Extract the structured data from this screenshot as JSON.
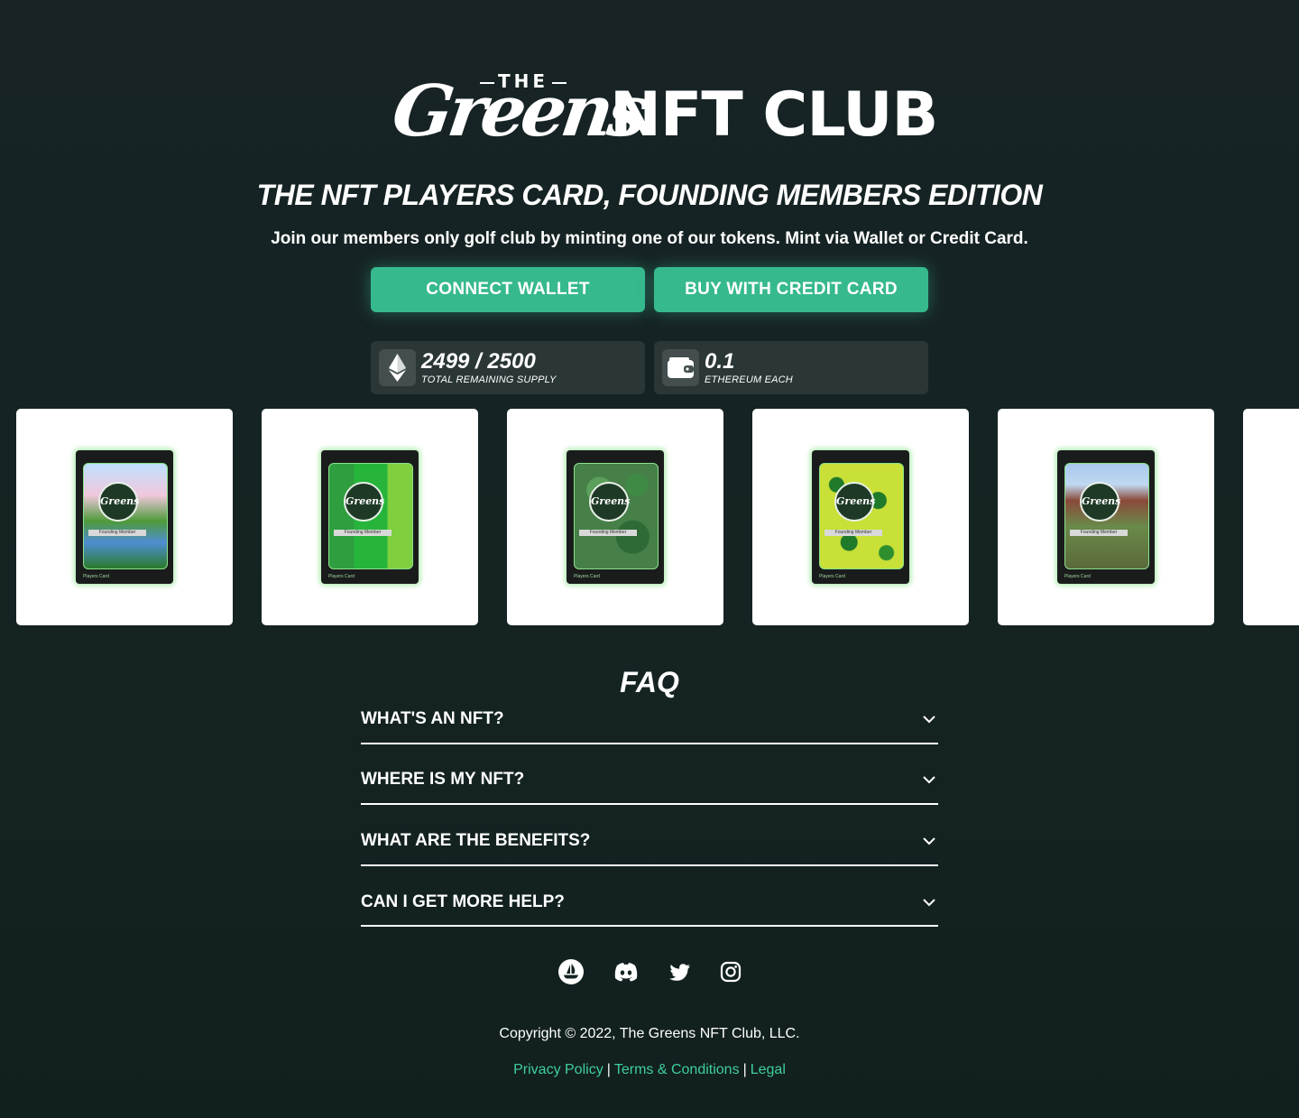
{
  "brand": {
    "the": "THE",
    "script": "Greens",
    "nft_club": "NFT CLUB"
  },
  "hero": {
    "headline": "THE NFT PLAYERS CARD, FOUNDING MEMBERS EDITION",
    "subheadline": "Join our members only golf club by minting one of our tokens. Mint via Wallet or Credit Card."
  },
  "buttons": {
    "connect_wallet": "CONNECT WALLET",
    "buy_credit_card": "BUY WITH CREDIT CARD"
  },
  "stats": {
    "supply": {
      "value": "2499 / 2500",
      "label": "TOTAL REMAINING SUPPLY",
      "icon": "ethereum-icon"
    },
    "price": {
      "value": "0.1",
      "label": "ETHEREUM EACH",
      "icon": "wallet-icon"
    }
  },
  "cards": [
    {
      "badge": "Greens",
      "ribbon": "Founding Member",
      "footer": "Players Card",
      "theme": "landscape"
    },
    {
      "badge": "Greens",
      "ribbon": "Founding Member",
      "footer": "Players Card",
      "theme": "stripes"
    },
    {
      "badge": "Greens",
      "ribbon": "Founding Member",
      "footer": "Players Card",
      "theme": "camo"
    },
    {
      "badge": "Greens",
      "ribbon": "Founding Member",
      "footer": "Players Card",
      "theme": "leopard"
    },
    {
      "badge": "Greens",
      "ribbon": "Founding Member",
      "footer": "Players Card",
      "theme": "castle"
    }
  ],
  "faq": {
    "title": "FAQ",
    "items": [
      {
        "question": "WHAT'S AN NFT?"
      },
      {
        "question": "WHERE IS MY NFT?"
      },
      {
        "question": "WHAT ARE THE BENEFITS?"
      },
      {
        "question": "CAN I GET MORE HELP?"
      }
    ]
  },
  "social": [
    "opensea-icon",
    "discord-icon",
    "twitter-icon",
    "instagram-icon"
  ],
  "footer": {
    "copyright": "Copyright © 2022, The Greens NFT Club, LLC.",
    "privacy": "Privacy Policy",
    "terms": "Terms & Conditions",
    "legal": "Legal",
    "separator": "|"
  },
  "colors": {
    "background": "#152323",
    "accent": "#36b98d",
    "link": "#3fcf9a",
    "stat_bg": "#2b3637"
  }
}
